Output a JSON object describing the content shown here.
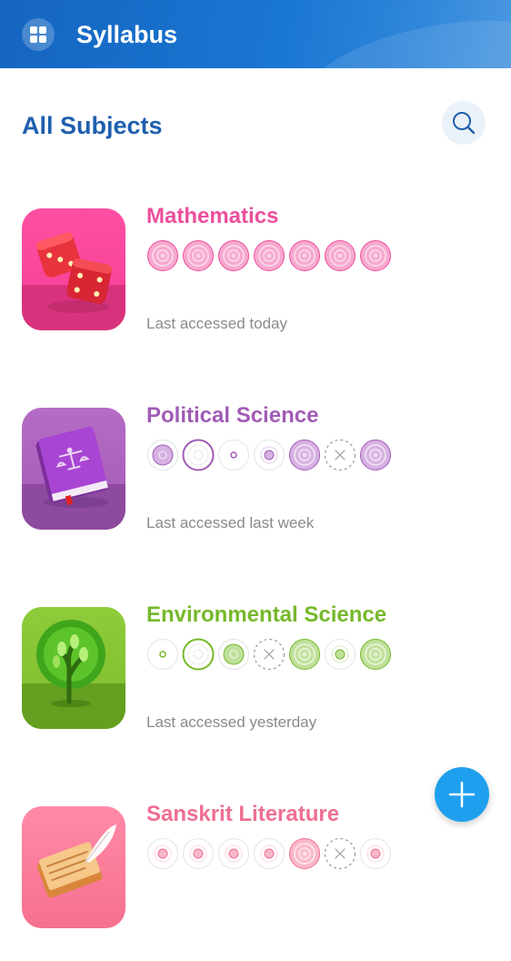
{
  "app": {
    "title": "Syllabus",
    "accent": "#1976d2"
  },
  "header": {
    "menu_icon": "grid-menu-icon",
    "search_icon": "search-icon"
  },
  "section": {
    "title": "All Subjects"
  },
  "subjects": [
    {
      "name": "Mathematics",
      "color": "#ec4f9c",
      "fill": "#f7a8cf",
      "light": "#fbd3e6",
      "last_accessed": "Last accessed today",
      "image": "dice-icon",
      "progress": [
        "full",
        "full",
        "full",
        "full",
        "full",
        "full",
        "full"
      ]
    },
    {
      "name": "Political Science",
      "color": "#a05cb5",
      "fill": "#d6b1e2",
      "light": "#ecdcf1",
      "last_accessed": "Last accessed last week",
      "image": "law-book-icon",
      "progress": [
        "half",
        "open",
        "dot",
        "small",
        "full",
        "cross",
        "full"
      ]
    },
    {
      "name": "Environmental Science",
      "color": "#76b82a",
      "fill": "#bfe09a",
      "light": "#e3f1d3",
      "last_accessed": "Last accessed yesterday",
      "image": "tree-icon",
      "progress": [
        "dot",
        "open",
        "half",
        "cross",
        "full",
        "small",
        "full"
      ]
    },
    {
      "name": "Sanskrit Literature",
      "color": "#ee6f92",
      "fill": "#f9b8c8",
      "light": "#fde1e8",
      "last_accessed": "",
      "image": "manuscript-quill-icon",
      "progress": [
        "small",
        "small",
        "small",
        "small",
        "full",
        "cross",
        "small"
      ]
    }
  ],
  "fab": {
    "icon": "plus-icon"
  }
}
